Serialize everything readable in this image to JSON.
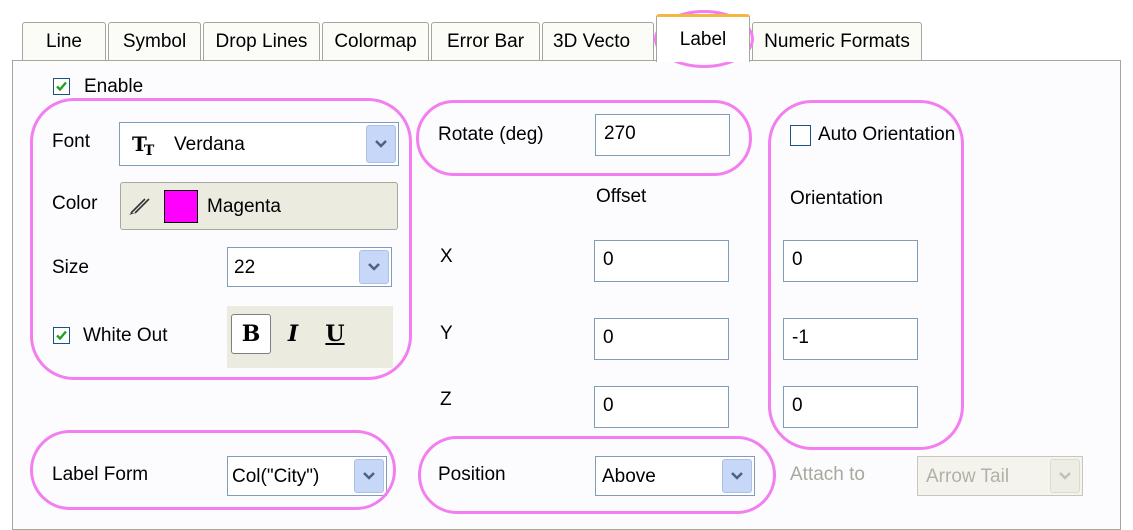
{
  "tabs": [
    {
      "label": "Line"
    },
    {
      "label": "Symbol"
    },
    {
      "label": "Drop Lines"
    },
    {
      "label": "Colormap"
    },
    {
      "label": "Error Bar"
    },
    {
      "label": "3D Vecto"
    },
    {
      "label": "Label",
      "active": true
    },
    {
      "label": "Numeric Formats"
    }
  ],
  "enable": {
    "label": "Enable",
    "checked": true
  },
  "font": {
    "label": "Font",
    "value": "Verdana",
    "icon": "truetype-font-icon"
  },
  "color": {
    "label": "Color",
    "value": "Magenta",
    "swatch": "#ff00ff",
    "icon": "pencil-icon"
  },
  "size": {
    "label": "Size",
    "value": "22"
  },
  "white_out": {
    "label": "White Out",
    "checked": true
  },
  "text_styles": {
    "bold": "B",
    "italic": "I",
    "underline": "U"
  },
  "rotate": {
    "label": "Rotate (deg)",
    "value": "270"
  },
  "offset": {
    "header": "Offset",
    "x_label": "X",
    "y_label": "Y",
    "z_label": "Z",
    "x": "0",
    "y": "0",
    "z": "0"
  },
  "auto_orientation": {
    "label": "Auto Orientation",
    "checked": false
  },
  "orientation": {
    "header": "Orientation",
    "x": "0",
    "y": "-1",
    "z": "0"
  },
  "label_form": {
    "label": "Label Form",
    "value": "Col(\"City\")"
  },
  "position": {
    "label": "Position",
    "value": "Above"
  },
  "attach_to": {
    "label": "Attach to",
    "value": "Arrow Tail",
    "disabled": true
  },
  "colors": {
    "highlight": "#f27ef0",
    "tab_accent": "#f5b646",
    "check": "#21a121"
  }
}
